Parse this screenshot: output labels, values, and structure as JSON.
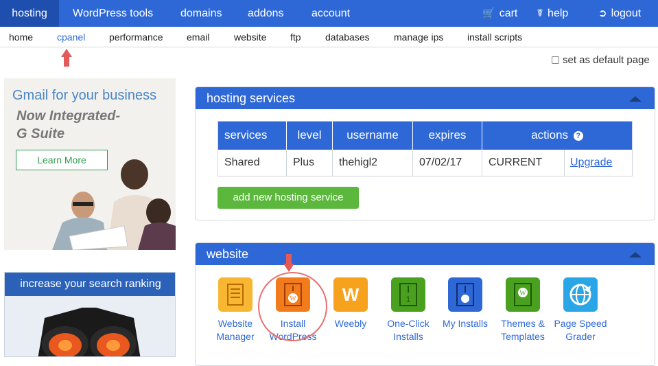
{
  "topnav": {
    "hosting": "hosting",
    "wordpress_tools": "WordPress tools",
    "domains": "domains",
    "addons": "addons",
    "account": "account",
    "cart": "cart",
    "help": "help",
    "logout": "logout",
    "active_color": "#1f4fae",
    "bar_color": "#2e68d6"
  },
  "subnav": {
    "home": "home",
    "cpanel": "cpanel",
    "performance": "performance",
    "email": "email",
    "website": "website",
    "ftp": "ftp",
    "databases": "databases",
    "manage_ips": "manage ips",
    "install_scripts": "install scripts"
  },
  "default_page_label": "set as default page",
  "gmail_ad": {
    "title": "Gmail for your business",
    "subtitle": "Now Integrated-\nG Suite",
    "button": "Learn More"
  },
  "search_ad": {
    "title": "increase your search ranking"
  },
  "hosting_panel": {
    "title": "hosting services",
    "headers": [
      "services",
      "level",
      "username",
      "expires",
      "actions"
    ],
    "row": [
      "Shared",
      "Plus",
      "thehigl2",
      "07/02/17",
      "CURRENT",
      "Upgrade"
    ],
    "add_button": "add new hosting service"
  },
  "website_panel": {
    "title": "website",
    "items": [
      {
        "line1": "Website",
        "line2": "Manager",
        "icon": "website-manager-icon",
        "color": "#f7b733"
      },
      {
        "line1": "Install",
        "line2": "WordPress",
        "icon": "install-wordpress-icon",
        "color": "#f27b1c"
      },
      {
        "line1": "Weebly",
        "line2": "",
        "icon": "weebly-icon",
        "color": "#f7a21c"
      },
      {
        "line1": "One-Click",
        "line2": "Installs",
        "icon": "one-click-installs-icon",
        "color": "#4aa120"
      },
      {
        "line1": "My Installs",
        "line2": "",
        "icon": "my-installs-icon",
        "color": "#2e68d6"
      },
      {
        "line1": "Themes &",
        "line2": "Templates",
        "icon": "themes-templates-icon",
        "color": "#4aa120"
      },
      {
        "line1": "Page Speed",
        "line2": "Grader",
        "icon": "page-speed-grader-icon",
        "color": "#2aa6e6"
      }
    ]
  }
}
